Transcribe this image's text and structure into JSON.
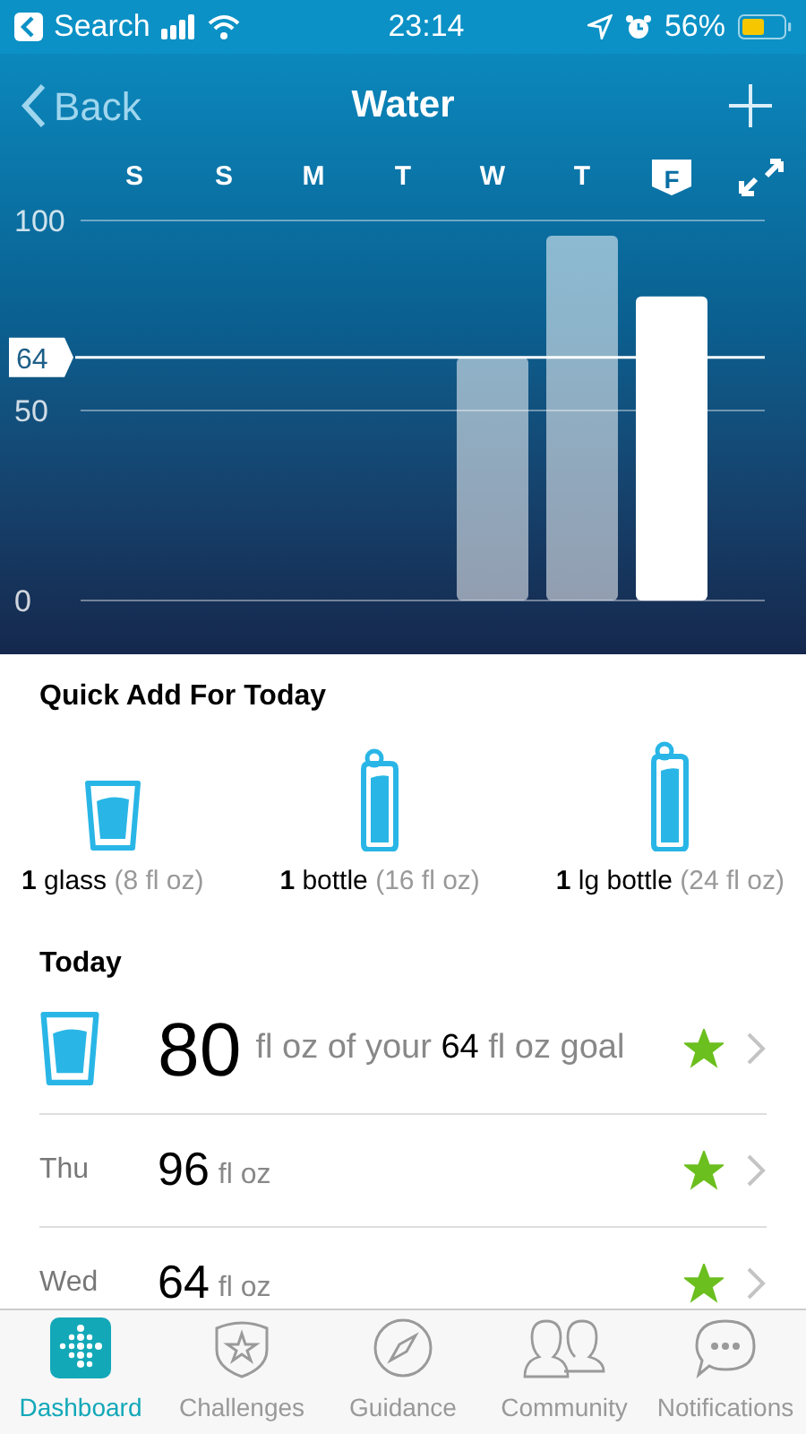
{
  "status_bar": {
    "back_app": "Search",
    "time": "23:14",
    "battery": "56%"
  },
  "header": {
    "back": "Back",
    "title": "Water"
  },
  "days": [
    {
      "label": "S",
      "selected": false
    },
    {
      "label": "S",
      "selected": false
    },
    {
      "label": "M",
      "selected": false
    },
    {
      "label": "T",
      "selected": false
    },
    {
      "label": "W",
      "selected": false
    },
    {
      "label": "T",
      "selected": false
    },
    {
      "label": "F",
      "selected": true
    }
  ],
  "chart_data": {
    "type": "bar",
    "values": [
      null,
      null,
      null,
      null,
      64,
      96,
      80
    ],
    "ylim": [
      0,
      100
    ],
    "yticks": [
      0,
      50,
      100
    ],
    "ref_lines": [
      {
        "axis": "y",
        "value": 64,
        "label": "64"
      }
    ]
  },
  "quick_add": {
    "title": "Quick Add For Today",
    "items": [
      {
        "kind": "glass",
        "count": "1",
        "name": "glass",
        "amount": "(8 fl oz)"
      },
      {
        "kind": "bottle",
        "count": "1",
        "name": "bottle",
        "amount": "(16 fl oz)"
      },
      {
        "kind": "large_bottle",
        "count": "1",
        "name": "lg bottle",
        "amount": "(24 fl oz)"
      }
    ]
  },
  "today": {
    "title": "Today",
    "amount": "80",
    "text": "fl oz of your",
    "goal": "64",
    "goal_unit": "fl oz goal",
    "star": true
  },
  "history": [
    {
      "day": "Thu",
      "amount": "96",
      "unit": "fl oz",
      "star": true
    },
    {
      "day": "Wed",
      "amount": "64",
      "unit": "fl oz",
      "star": true
    }
  ],
  "tabs": [
    {
      "label": "Dashboard",
      "selected": true
    },
    {
      "label": "Challenges",
      "selected": false
    },
    {
      "label": "Guidance",
      "selected": false
    },
    {
      "label": "Community",
      "selected": false
    },
    {
      "label": "Notifications",
      "selected": false
    }
  ]
}
